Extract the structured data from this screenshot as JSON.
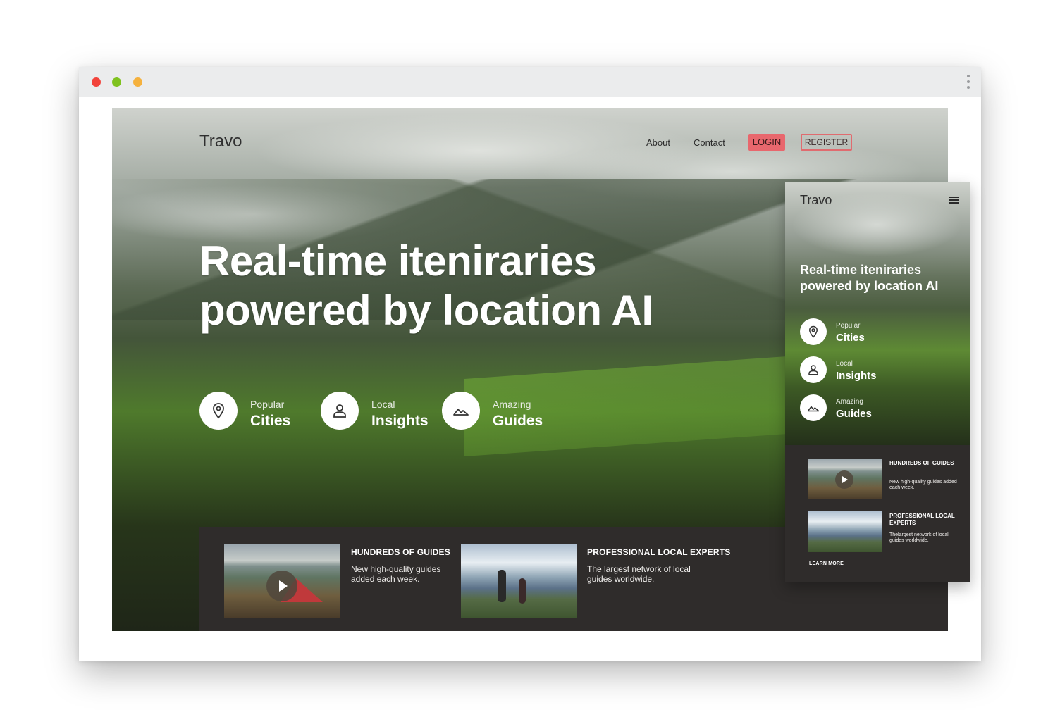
{
  "window": {
    "controls": [
      "close",
      "minimize",
      "maximize"
    ],
    "menu_icon": "kebab-menu-icon"
  },
  "site": {
    "logo": "Travo",
    "nav": {
      "about": "About",
      "contact": "Contact",
      "login": "LOGIN",
      "register": "REGISTER"
    },
    "headline_line1": "Real-time iteniraries",
    "headline_line2": "powered by location AI",
    "features": [
      {
        "small": "Popular",
        "big": "Cities",
        "icon": "location-pin-icon"
      },
      {
        "small": "Local",
        "big": "Insights",
        "icon": "person-icon"
      },
      {
        "small": "Amazing",
        "big": "Guides",
        "icon": "mountain-icon"
      }
    ],
    "cards": [
      {
        "title": "HUNDREDS OF GUIDES",
        "desc": "New  high-quality guides added each week."
      },
      {
        "title": "PROFESSIONAL LOCAL EXPERTS",
        "desc": "The largest network of local guides worldwide."
      }
    ]
  },
  "mobile": {
    "logo": "Travo",
    "menu_icon": "hamburger-menu-icon",
    "headline": "Real-time iteniraries powered by location AI",
    "features": [
      {
        "small": "Popular",
        "big": "Cities"
      },
      {
        "small": "Local",
        "big": "Insights"
      },
      {
        "small": "Amazing",
        "big": "Guides"
      }
    ],
    "cards": [
      {
        "title": "HUNDREDS OF GUIDES",
        "desc": "New  high-quality guides added each week."
      },
      {
        "title": "PROFESSIONAL LOCAL EXPERTS",
        "desc": "Thelargest network of local guides worldwide."
      }
    ],
    "learn_more": "LEARN MORE"
  },
  "colors": {
    "accent": "#e8676d",
    "panel": "#2f2c2b",
    "titlebar": "#ebeced"
  }
}
